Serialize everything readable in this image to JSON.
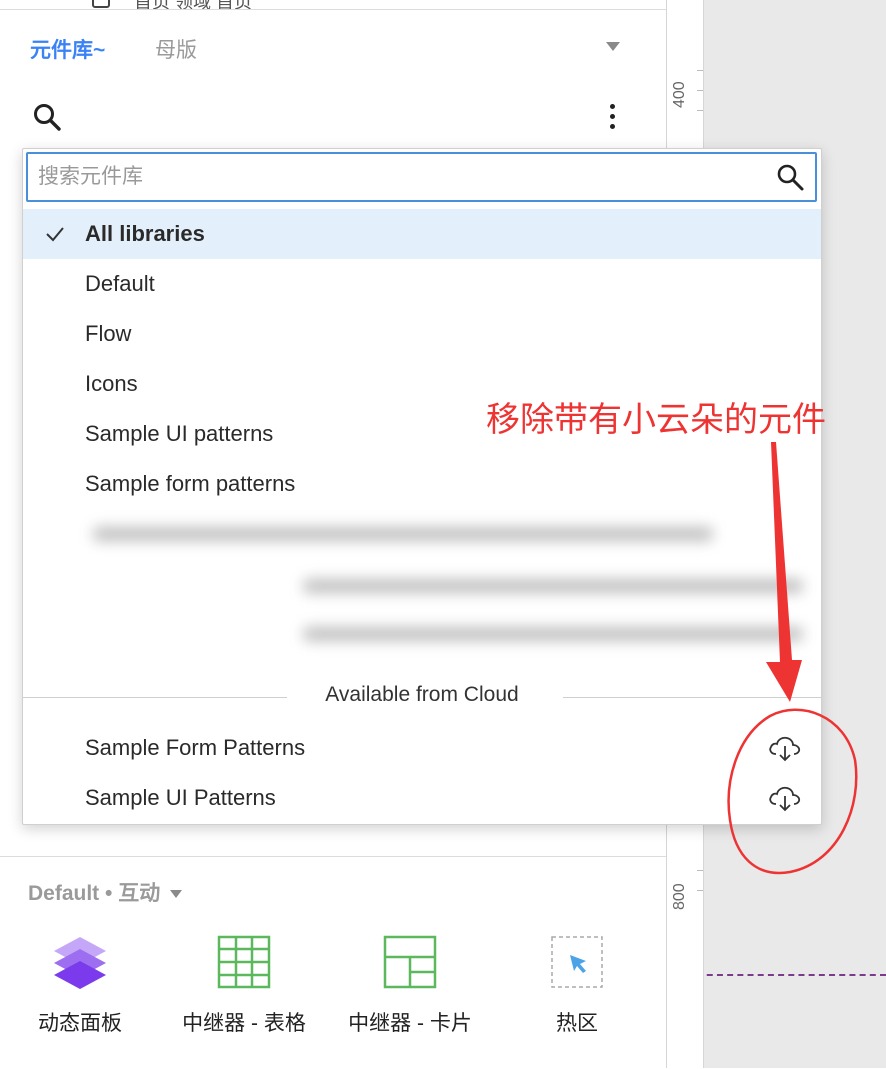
{
  "top_strip": {
    "partial_text": "首页 领域 首页"
  },
  "tabs": {
    "active": "元件库~",
    "inactive": "母版"
  },
  "dropdown": {
    "search_placeholder": "搜索元件库",
    "libraries": [
      {
        "label": "All libraries",
        "selected": true
      },
      {
        "label": "Default",
        "selected": false
      },
      {
        "label": "Flow",
        "selected": false
      },
      {
        "label": "Icons",
        "selected": false
      },
      {
        "label": "Sample UI patterns",
        "selected": false
      },
      {
        "label": "Sample form patterns",
        "selected": false
      }
    ],
    "cloud_section_title": "Available from Cloud",
    "cloud_items": [
      {
        "label": "Sample Form Patterns",
        "icon": "cloud-download-icon"
      },
      {
        "label": "Sample UI Patterns",
        "icon": "cloud-download-icon"
      }
    ]
  },
  "annotation": {
    "text": "移除带有小云朵的元件",
    "color": "#ee3333"
  },
  "ruler": {
    "labels": [
      "400",
      "800"
    ]
  },
  "bottom": {
    "library_selector": "Default • 互动",
    "widgets": [
      {
        "label": "动态面板",
        "icon": "dynamic-panel-icon"
      },
      {
        "label": "中继器 - 表格",
        "icon": "repeater-table-icon"
      },
      {
        "label": "中继器 - 卡片",
        "icon": "repeater-card-icon"
      },
      {
        "label": "热区",
        "icon": "hotspot-icon"
      }
    ]
  },
  "colors": {
    "accent": "#3b82f6",
    "selected_row": "#e3f0fb",
    "widget_green": "#5cb85c",
    "widget_purple": "#8b5cf6"
  }
}
